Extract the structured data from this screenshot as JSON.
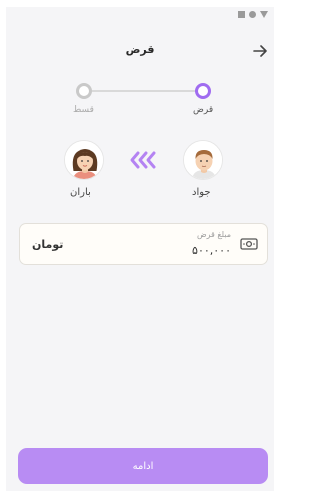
{
  "header": {
    "title": "قرض",
    "back_icon": "arrow-back-icon"
  },
  "status_bar": {
    "icons": [
      "square-icon",
      "circle-icon",
      "triangle-icon"
    ]
  },
  "stepper": {
    "steps": [
      {
        "label": "قرض",
        "state": "active"
      },
      {
        "label": "قسط",
        "state": "inactive"
      }
    ],
    "accent_color": "#a06cf0",
    "inactive_color": "#c9c9c9"
  },
  "transfer": {
    "from": {
      "name": "جواد",
      "avatar": "male-avatar-icon"
    },
    "to": {
      "name": "باران",
      "avatar": "female-avatar-icon"
    },
    "direction_icon": "triple-chevron-left-icon"
  },
  "amount": {
    "caption": "مبلغ قرض",
    "value": "۵۰۰,۰۰۰",
    "unit": "تومان",
    "icon": "money-icon"
  },
  "footer": {
    "continue_label": "ادامه",
    "button_color": "#b88cf3"
  }
}
